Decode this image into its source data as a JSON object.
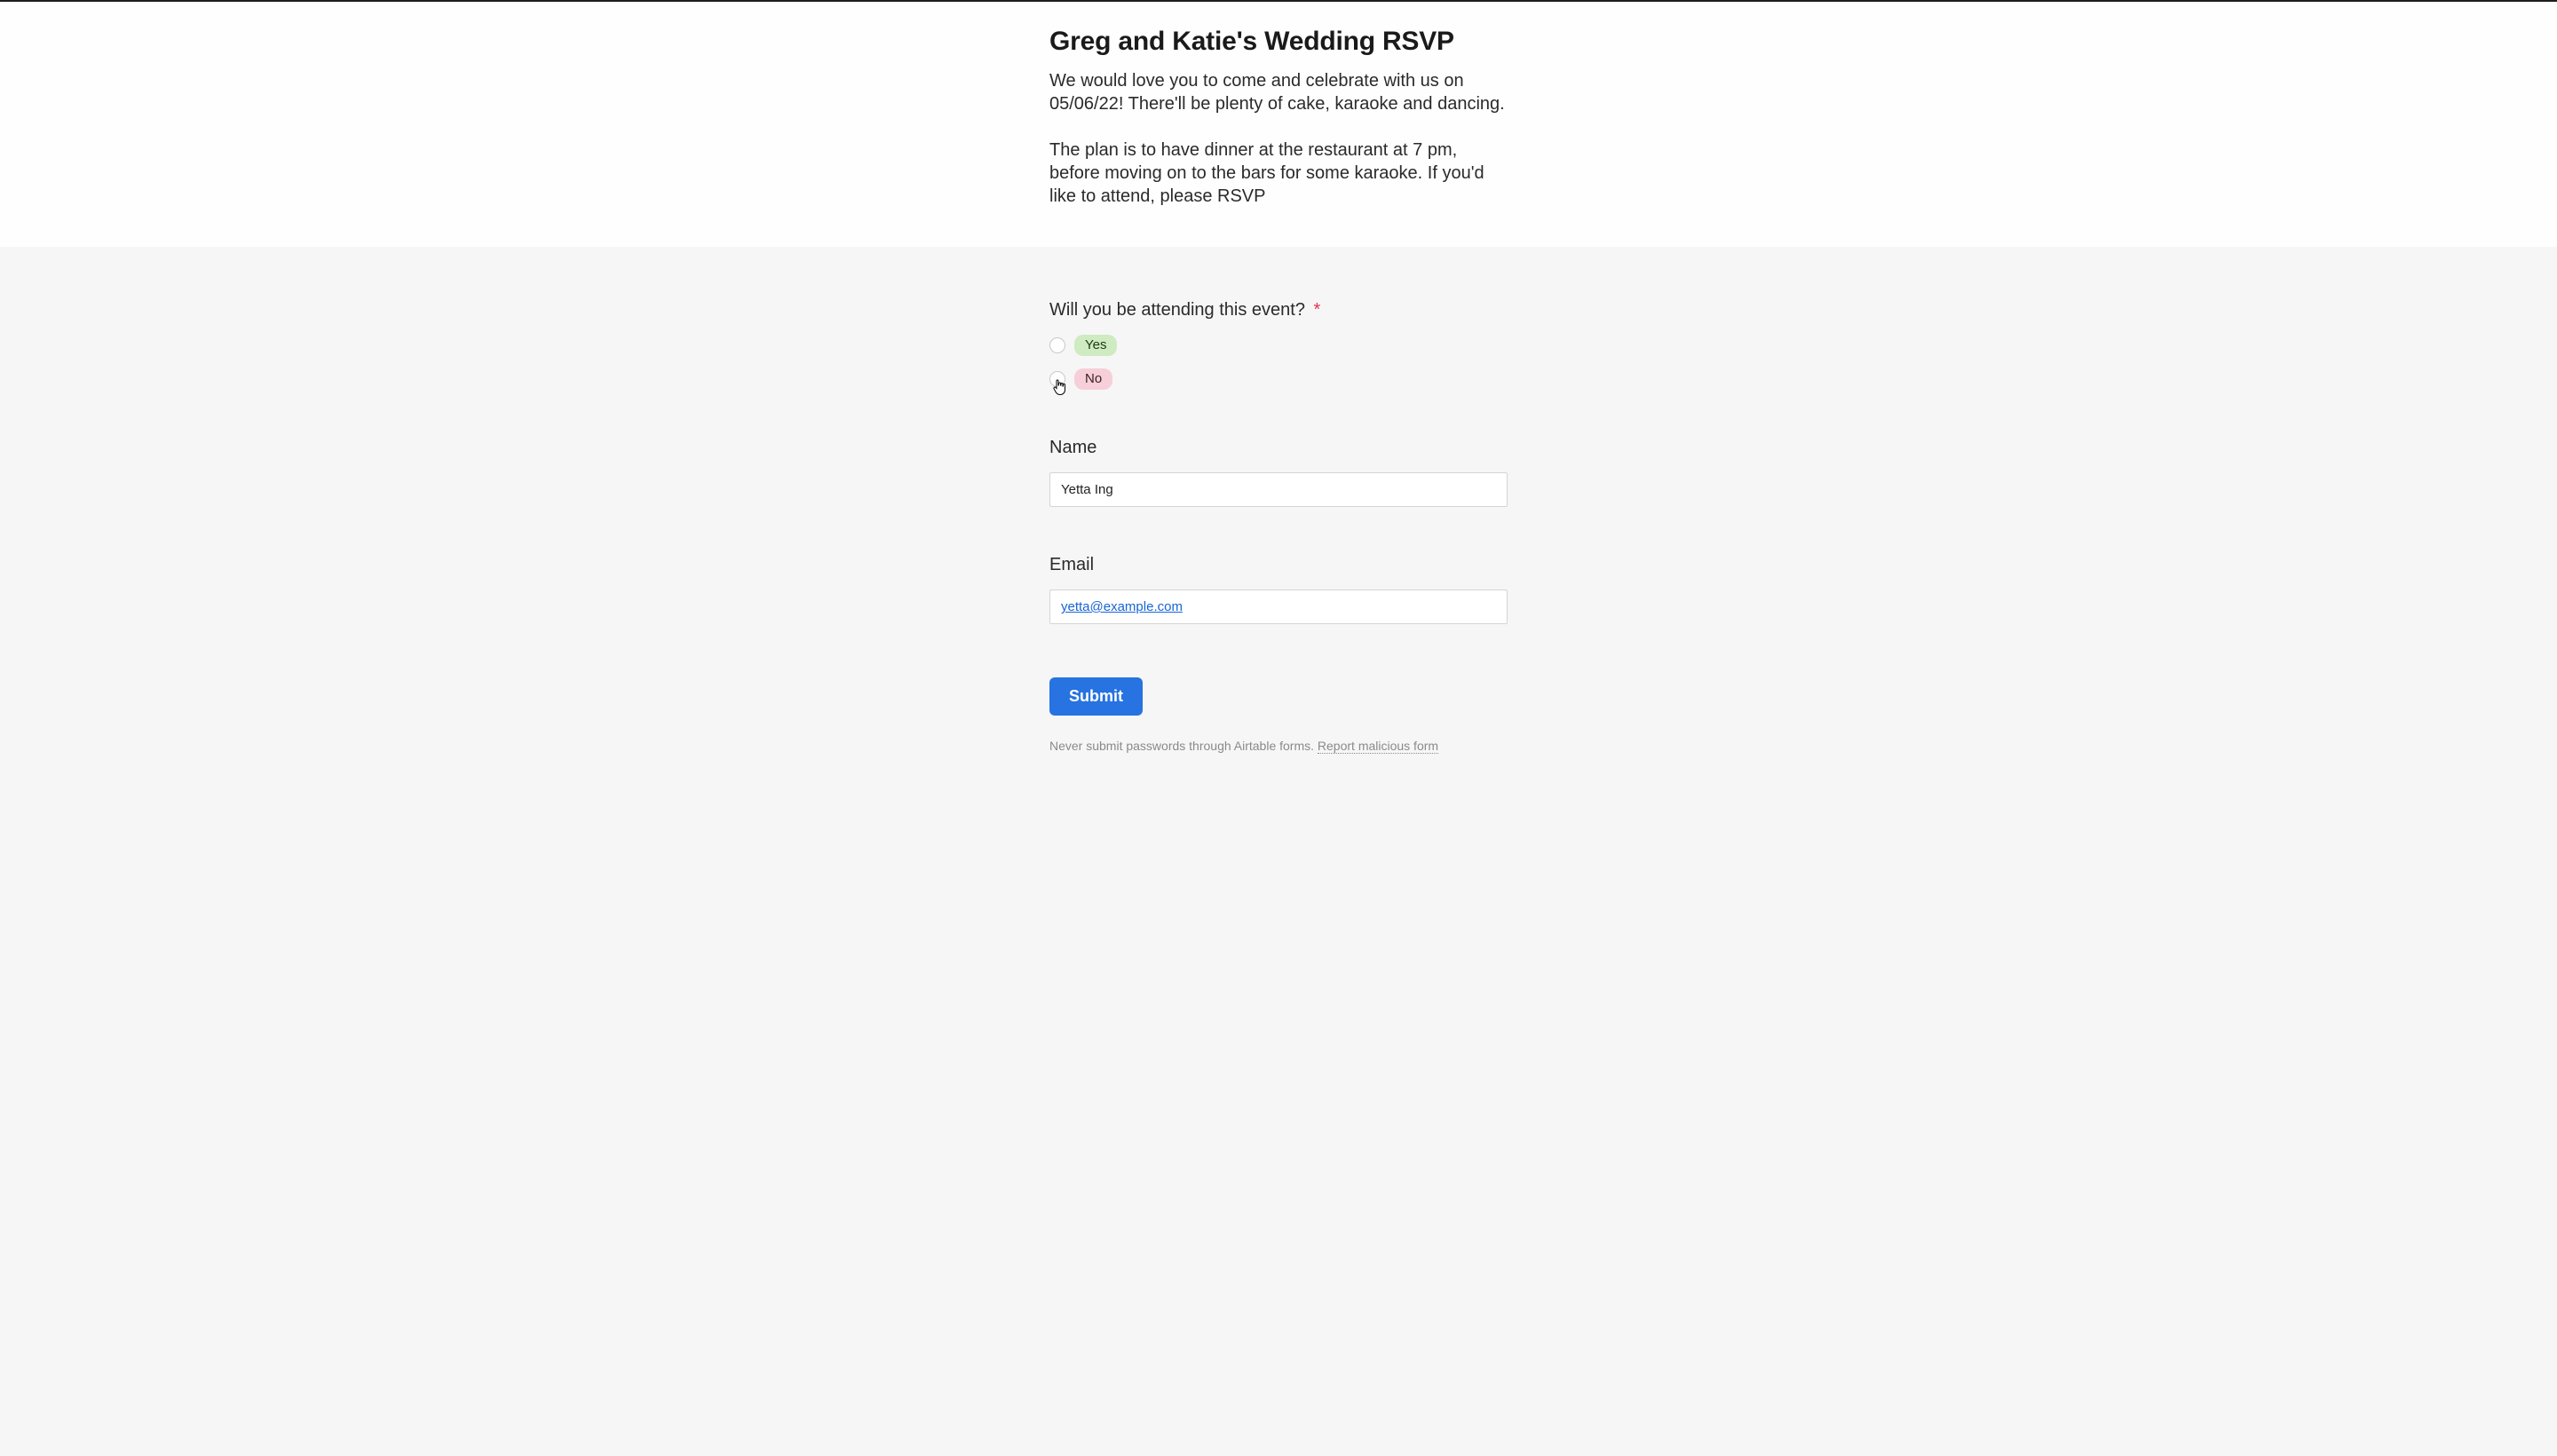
{
  "header": {
    "title": "Greg and Katie's Wedding RSVP",
    "description": "We would love you to come and celebrate with us on 05/06/22! There'll be plenty of cake, karaoke and dancing.\n\nThe plan is to have dinner at the restaurant at 7 pm, before moving on to the bars for some karaoke. If you'd like to attend, please RSVP"
  },
  "fields": {
    "attending": {
      "label": "Will you be attending this event?",
      "required": true,
      "options": {
        "yes": "Yes",
        "no": "No"
      },
      "selected": null
    },
    "name": {
      "label": "Name",
      "value": "Yetta Ing"
    },
    "email": {
      "label": "Email",
      "value": "yetta@example.com"
    }
  },
  "submit": {
    "label": "Submit"
  },
  "footer": {
    "note": "Never submit passwords through Airtable forms.",
    "report": "Report malicious form"
  }
}
